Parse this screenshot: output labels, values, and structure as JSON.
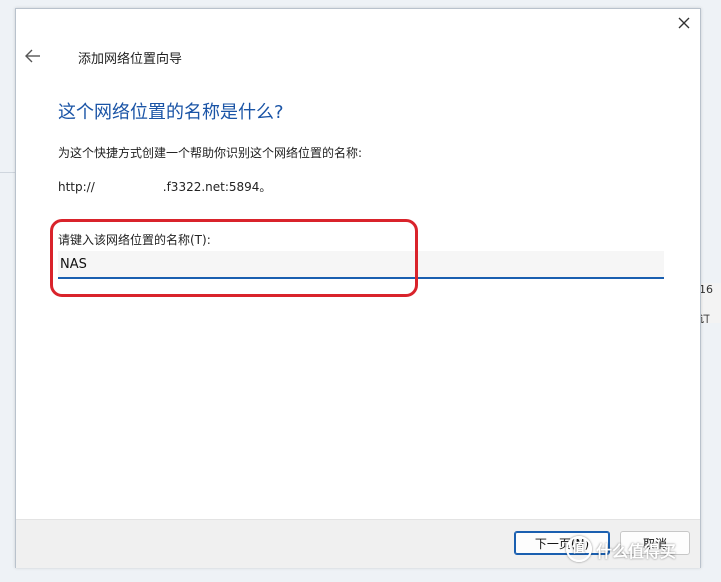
{
  "dialog": {
    "wizard_title": "添加网络位置向导",
    "heading": "这个网络位置的名称是什么?",
    "instruction": "为这个快捷方式创建一个帮助你识别这个网络位置的名称:",
    "address_prefix": "http://",
    "address_suffix": ".f3322.net:5894。",
    "field_label": "请键入该网络位置的名称(T):",
    "name_value": "NAS",
    "back_icon": "back-arrow-icon",
    "close_icon": "close-icon"
  },
  "footer": {
    "next_label": "下一页(N)",
    "cancel_label": "取消"
  },
  "background": {
    "edge_text_1": "16",
    "edge_text_2": "订"
  },
  "watermark": {
    "logo_glyph": "值",
    "text": "什么值得买"
  },
  "colors": {
    "heading": "#1a54a6",
    "highlight": "#d9232b",
    "accent": "#1a5fb0"
  }
}
